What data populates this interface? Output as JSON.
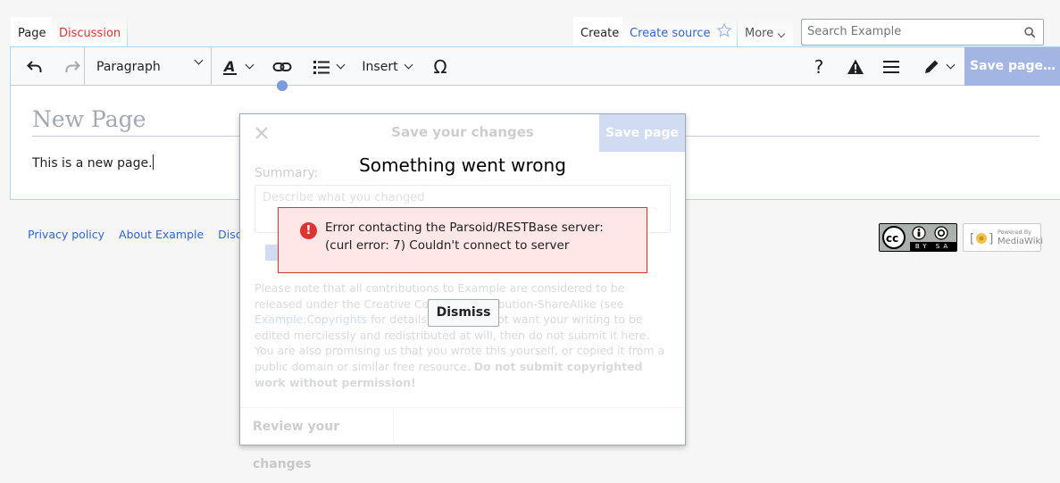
{
  "tabs": {
    "left": [
      {
        "label": "Page",
        "state": "selected"
      },
      {
        "label": "Discussion",
        "state": "new"
      }
    ],
    "right": [
      {
        "label": "Create",
        "state": "selected"
      },
      {
        "label": "Create source",
        "state": "link"
      }
    ],
    "more_label": "More"
  },
  "search": {
    "placeholder": "Search Example"
  },
  "toolbar": {
    "paragraph_label": "Paragraph",
    "insert_label": "Insert",
    "save_label": "Save page…"
  },
  "page": {
    "title_placeholder": "New Page",
    "body_text": "This is a new page."
  },
  "footer": {
    "links": [
      "Privacy policy",
      "About Example",
      "Disclaime"
    ],
    "cc_badge": "BY SA",
    "powered_line1": "Powered By",
    "powered_line2": "MediaWiki"
  },
  "dialog": {
    "title": "Save your changes",
    "save_label": "Save page",
    "summary_label": "Summary:",
    "summary_placeholder": "Describe what you changed",
    "license_text_1": "Please note that all contributions to Example are considered to be released under the Creative Commons Attribution-ShareAlike (see ",
    "license_link": "Example:Copyrights",
    "license_text_2": " for details). If you do not want your writing to be edited mercilessly and redistributed at will, then do not submit it here.",
    "license_text_3": "You are also promising us that you wrote this yourself, or copied it from a public domain or similar free resource. ",
    "license_bold": "Do not submit copyrighted work without permission!",
    "review_label": "Review your changes"
  },
  "error": {
    "title": "Something went wrong",
    "message": "Error contacting the Parsoid/RESTBase server: (curl error: 7) Couldn't connect to server",
    "dismiss_label": "Dismiss"
  },
  "colors": {
    "accent": "#3366cc",
    "save_disabled": "#a3b6e3",
    "error_border": "#dd3333",
    "error_bg": "#fee7e6"
  }
}
